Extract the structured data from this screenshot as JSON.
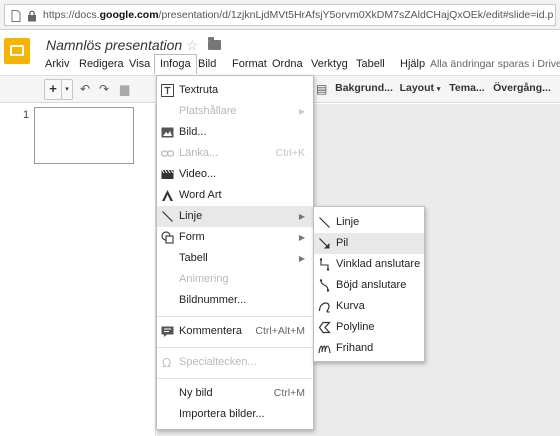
{
  "browser": {
    "url_prefix": "https://docs.",
    "url_domain": "google.com",
    "url_suffix": "/presentation/d/1zjknLjdMVt5HrAfsjY5orvm0XkDM7sZAldCHajQxOEk/edit#slide=id.p"
  },
  "app": {
    "title": "Namnlös presentation",
    "save_status": "Alla ändringar sparas i Drive",
    "menu": [
      "Arkiv",
      "Redigera",
      "Visa",
      "Infoga",
      "Bild",
      "Format",
      "Ordna",
      "Verktyg",
      "Tabell",
      "Hjälp"
    ],
    "active_menu": "Infoga"
  },
  "toolbar": {
    "background_label": "Bakgrund...",
    "layout_label": "Layout",
    "theme_label": "Tema...",
    "transition_label": "Övergång..."
  },
  "filmstrip": {
    "slide_number": "1"
  },
  "insert_menu": {
    "items": [
      {
        "label": "Textruta",
        "icon": "textbox-icon",
        "shortcut": "",
        "disabled": false,
        "submenu": false
      },
      {
        "label": "Platshållare",
        "icon": "",
        "shortcut": "",
        "disabled": true,
        "submenu": true
      },
      {
        "label": "Bild...",
        "icon": "image-icon",
        "shortcut": "",
        "disabled": false,
        "submenu": false
      },
      {
        "label": "Länka...",
        "icon": "link-icon",
        "shortcut": "Ctrl+K",
        "disabled": true,
        "submenu": false
      },
      {
        "label": "Video...",
        "icon": "video-icon",
        "shortcut": "",
        "disabled": false,
        "submenu": false
      },
      {
        "label": "Word Art",
        "icon": "wordart-icon",
        "shortcut": "",
        "disabled": false,
        "submenu": false
      },
      {
        "label": "Linje",
        "icon": "line-icon",
        "shortcut": "",
        "disabled": false,
        "submenu": true
      },
      {
        "label": "Form",
        "icon": "shape-icon",
        "shortcut": "",
        "disabled": false,
        "submenu": true
      },
      {
        "label": "Tabell",
        "icon": "",
        "shortcut": "",
        "disabled": false,
        "submenu": true
      },
      {
        "label": "Animering",
        "icon": "",
        "shortcut": "",
        "disabled": true,
        "submenu": false
      },
      {
        "label": "Bildnummer...",
        "icon": "",
        "shortcut": "",
        "disabled": false,
        "submenu": false
      },
      {
        "label": "Kommentera",
        "icon": "comment-icon",
        "shortcut": "Ctrl+Alt+M",
        "disabled": false,
        "submenu": false
      },
      {
        "label": "Specialtecken...",
        "icon": "omega-icon",
        "shortcut": "",
        "disabled": true,
        "submenu": false
      },
      {
        "label": "Ny bild",
        "icon": "",
        "shortcut": "Ctrl+M",
        "disabled": false,
        "submenu": false
      },
      {
        "label": "Importera bilder...",
        "icon": "",
        "shortcut": "",
        "disabled": false,
        "submenu": false
      }
    ]
  },
  "line_submenu": {
    "items": [
      {
        "label": "Linje",
        "icon": "line-icon"
      },
      {
        "label": "Pil",
        "icon": "arrow-icon"
      },
      {
        "label": "Vinklad anslutare",
        "icon": "elbow-connector-icon"
      },
      {
        "label": "Böjd anslutare",
        "icon": "curved-connector-icon"
      },
      {
        "label": "Kurva",
        "icon": "curve-icon"
      },
      {
        "label": "Polyline",
        "icon": "polyline-icon"
      },
      {
        "label": "Frihand",
        "icon": "scribble-icon"
      }
    ],
    "hovered": "Pil"
  }
}
